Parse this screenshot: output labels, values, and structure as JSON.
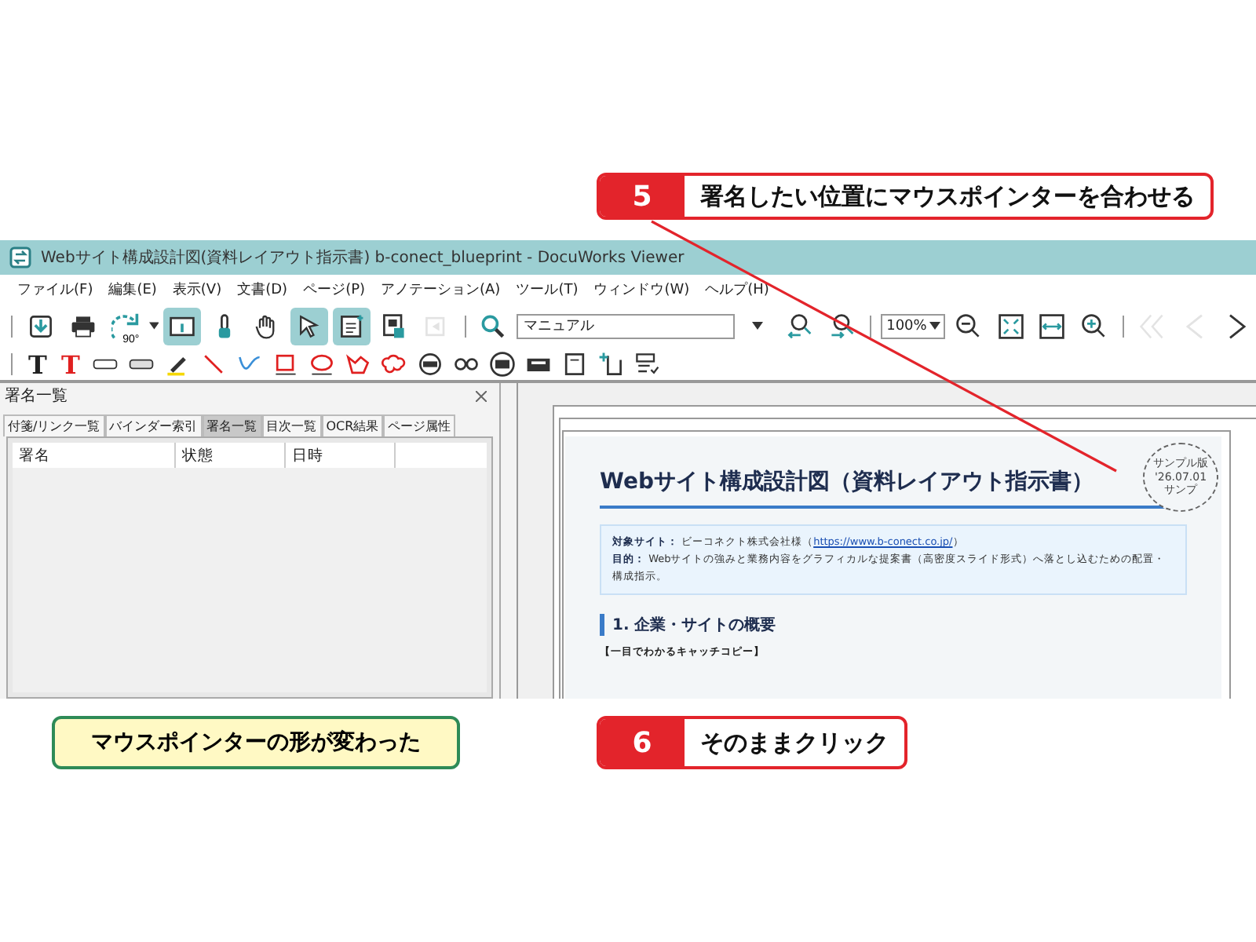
{
  "callouts_top": [
    {
      "number": "5",
      "text": "署名したい位置にマウスポインターを合わせる"
    }
  ],
  "window": {
    "title": "Webサイト構成設計図(資料レイアウト指示書) b-conect_blueprint - DocuWorks Viewer"
  },
  "menu": [
    "ファイル(F)",
    "編集(E)",
    "表示(V)",
    "文書(D)",
    "ページ(P)",
    "アノテーション(A)",
    "ツール(T)",
    "ウィンドウ(W)",
    "ヘルプ(H)"
  ],
  "toolbar": [
    {
      "kind": "download",
      "selected": false,
      "disabled": false
    },
    {
      "kind": "print",
      "selected": false,
      "disabled": false
    },
    {
      "kind": "rotate",
      "label": "90°",
      "selected": false,
      "disabled": false
    },
    {
      "kind": "info",
      "selected": true,
      "disabled": false
    },
    {
      "kind": "finger",
      "selected": false,
      "disabled": false
    },
    {
      "kind": "hand",
      "selected": false,
      "disabled": false
    },
    {
      "kind": "pointer",
      "selected": true,
      "disabled": false
    },
    {
      "kind": "note",
      "selected": true,
      "disabled": false
    },
    {
      "kind": "image",
      "selected": false,
      "disabled": false
    },
    {
      "kind": "attach",
      "selected": false,
      "disabled": true
    },
    {
      "kind": "search",
      "selected": false,
      "disabled": false
    },
    {
      "kind": "field",
      "value": "マニュアル"
    },
    {
      "kind": "find-prev",
      "selected": false,
      "disabled": false
    },
    {
      "kind": "find-next",
      "selected": false,
      "disabled": false
    },
    {
      "kind": "zoom",
      "value": "100%"
    },
    {
      "kind": "zoom-out",
      "selected": false,
      "disabled": false
    },
    {
      "kind": "fit-page",
      "selected": false,
      "disabled": false
    },
    {
      "kind": "fit-width",
      "selected": false,
      "disabled": false
    },
    {
      "kind": "zoom-in",
      "selected": false,
      "disabled": false
    },
    {
      "kind": "first",
      "selected": false,
      "disabled": true
    },
    {
      "kind": "prev",
      "selected": false,
      "disabled": true
    },
    {
      "kind": "next",
      "selected": false,
      "disabled": false
    }
  ],
  "annotation_toolbar": [
    {
      "kind": "text",
      "label": "T",
      "color": "#222222"
    },
    {
      "kind": "text",
      "label": "T",
      "color": "#e02020"
    },
    {
      "kind": "eraser"
    },
    {
      "kind": "marker"
    },
    {
      "kind": "highlighter"
    },
    {
      "kind": "line"
    },
    {
      "kind": "curve"
    },
    {
      "kind": "rect"
    },
    {
      "kind": "ellipse"
    },
    {
      "kind": "polygon"
    },
    {
      "kind": "cloud"
    },
    {
      "kind": "date-stamp"
    },
    {
      "kind": "link"
    },
    {
      "kind": "seal"
    },
    {
      "kind": "badge"
    },
    {
      "kind": "frame"
    },
    {
      "kind": "add-page"
    },
    {
      "kind": "checklist"
    }
  ],
  "panel": {
    "title": "署名一覧",
    "tabs": [
      {
        "label": "付箋/リンク一覧",
        "selected": false
      },
      {
        "label": "バインダー索引",
        "selected": false
      },
      {
        "label": "署名一覧",
        "selected": true
      },
      {
        "label": "目次一覧",
        "selected": false
      },
      {
        "label": "OCR結果",
        "selected": false
      },
      {
        "label": "ページ属性",
        "selected": false
      }
    ],
    "columns": [
      "署名",
      "状態",
      "日時"
    ]
  },
  "document": {
    "stamp": [
      "サンプル版",
      "'26.07.01",
      "サンプ"
    ],
    "title": "Webサイト構成設計図（資料レイアウト指示書）",
    "info": [
      {
        "label": "対象サイト：",
        "text": "ビーコネクト株式会社様（",
        "link": "https://www.b-conect.co.jp/",
        "after": "）"
      },
      {
        "label": "目的：",
        "text": "Webサイトの強みと業務内容をグラフィカルな提案書（高密度スライド形式）へ落とし込むための配置・構成指示。"
      }
    ],
    "heading": "1. 企業・サイトの概要",
    "subheading": "【一目でわかるキャッチコピー】"
  },
  "callouts_bottom": [
    {
      "kind": "note",
      "text": "マウスポインターの形が変わった"
    },
    {
      "kind": "step",
      "number": "6",
      "text": "そのままクリック"
    }
  ]
}
